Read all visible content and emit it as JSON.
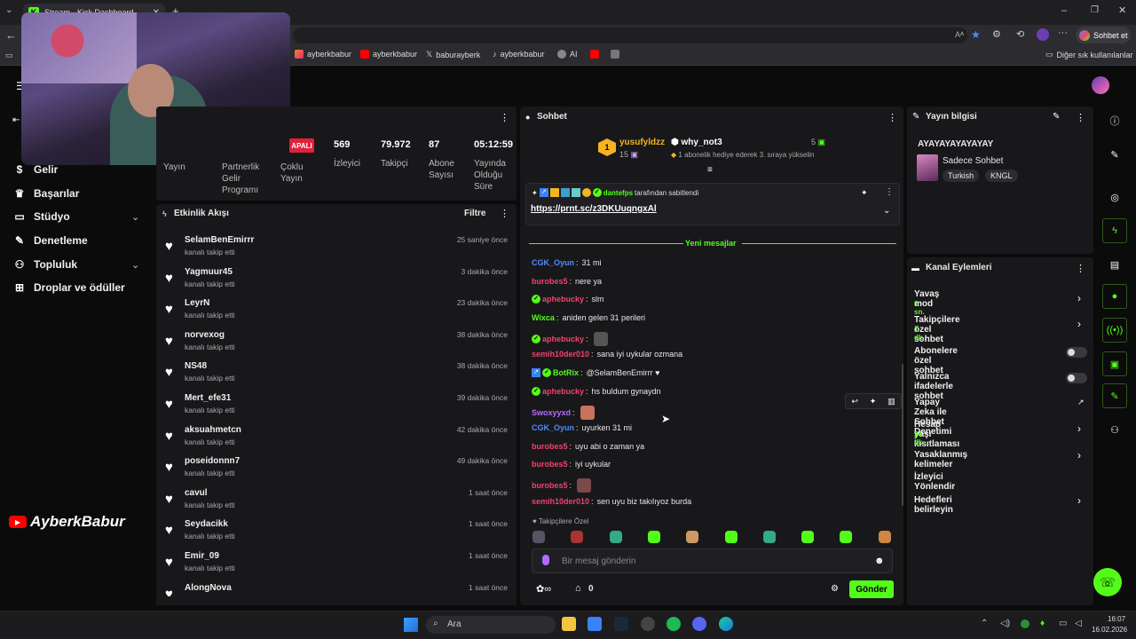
{
  "browser": {
    "tab_title": "Stream - Kick Dashboard",
    "copilot_label": "Sohbet et",
    "bookmarks": [
      "ayberkbabur",
      "ayberkbabur",
      "baburayberk",
      "ayberkbabur",
      "AI"
    ],
    "other_bookmarks": "Diğer sık kullanılanlar"
  },
  "sidebar": {
    "items": [
      {
        "label": "Gelir",
        "icon": "dollar-icon"
      },
      {
        "label": "Başarılar",
        "icon": "trophy-icon"
      },
      {
        "label": "Stüdyo",
        "icon": "studio-icon"
      },
      {
        "label": "Denetleme",
        "icon": "wrench-icon"
      },
      {
        "label": "Topluluk",
        "icon": "community-icon"
      },
      {
        "label": "Droplar ve ödüller",
        "icon": "gift-icon"
      }
    ],
    "watermark": "AyberkBabur"
  },
  "stats": {
    "badge": "APALI",
    "labels": [
      "Yayın",
      "Partnerlik Gelir Programı",
      "Çoklu Yayın"
    ],
    "items": [
      {
        "value": "569",
        "label": "İzleyici"
      },
      {
        "value": "79.972",
        "label": "Takipçi"
      },
      {
        "value": "87",
        "label": "Abone Sayısı"
      },
      {
        "value": "05:12:59",
        "label": "Yayında Olduğu Süre"
      }
    ]
  },
  "activity": {
    "title": "Etkinlik Akışı",
    "filter_label": "Filtre",
    "items": [
      {
        "name": "SelamBenEmirrr",
        "action": "kanalı takip etti",
        "time": "25 saniye önce"
      },
      {
        "name": "Yagmuur45",
        "action": "kanalı takip etti",
        "time": "3 dakika önce"
      },
      {
        "name": "LeyrN",
        "action": "kanalı takip etti",
        "time": "23 dakika önce"
      },
      {
        "name": "norvexog",
        "action": "kanalı takip etti",
        "time": "38 dakika önce"
      },
      {
        "name": "NS48",
        "action": "kanalı takip etti",
        "time": "38 dakika önce"
      },
      {
        "name": "Mert_efe31",
        "action": "kanalı takip etti",
        "time": "39 dakika önce"
      },
      {
        "name": "aksuahmetcn",
        "action": "kanalı takip etti",
        "time": "42 dakika önce"
      },
      {
        "name": "poseidonnn7",
        "action": "kanalı takip etti",
        "time": "49 dakika önce"
      },
      {
        "name": "cavul",
        "action": "kanalı takip etti",
        "time": "1 saat önce"
      },
      {
        "name": "Seydacikk",
        "action": "kanalı takip etti",
        "time": "1 saat önce"
      },
      {
        "name": "Emir_09",
        "action": "kanalı takip etti",
        "time": "1 saat önce"
      },
      {
        "name": "AlongNova",
        "action": "kanalı takip etti",
        "time": "1 saat önce"
      }
    ]
  },
  "chat": {
    "title": "Sohbet",
    "gift_top_user": "yusufyldzz",
    "gift_top_count": "15",
    "gift_user": "why_not3",
    "gift_count": "5",
    "gift_text": "1 abonelik hediye ederek 3. sıraya yükselin",
    "pinned_by": "dantefps",
    "pinned_suffix": "tarafından sabitlendi",
    "pinned_link": "https://prnt.sc/z3DKUuqngxAl",
    "new_messages": "Yeni mesajlar",
    "messages": [
      {
        "user": "CGK_Oyun",
        "text": "31 mi",
        "color": "#4f8df9"
      },
      {
        "user": "burobes5",
        "text": "nere ya",
        "color": "#f0426b"
      },
      {
        "user": "aphebucky",
        "text": "slm",
        "color": "#f0426b"
      },
      {
        "user": "Wixca",
        "text": "aniden gelen 31 perileri",
        "color": "#53fc18"
      },
      {
        "user": "aphebucky",
        "text": "",
        "color": "#f0426b"
      },
      {
        "user": "semih10der010",
        "text": "sana iyi uykular ozmana",
        "color": "#f0426b"
      },
      {
        "user": "BotRix",
        "text": "@SelamBenEmirrr ♥",
        "color": "#53fc18"
      },
      {
        "user": "aphebucky",
        "text": "hs buldum gynaydn",
        "color": "#f0426b"
      },
      {
        "user": "Swoxyyxd",
        "text": "",
        "color": "#b36cff"
      },
      {
        "user": "CGK_Oyun",
        "text": "uyurken 31 mi",
        "color": "#4f8df9"
      },
      {
        "user": "burobes5",
        "text": "uyu abi o zaman ya",
        "color": "#f0426b"
      },
      {
        "user": "burobes5",
        "text": "iyi uykular",
        "color": "#f0426b"
      },
      {
        "user": "burobes5",
        "text": "",
        "color": "#f0426b"
      },
      {
        "user": "semih10der010",
        "text": "sen uyu biz takılıyoz burda",
        "color": "#f0426b"
      }
    ],
    "followers_only": "Takipçilere Özel",
    "input_placeholder": "Bir mesaj gönderin",
    "points": "0",
    "send_label": "Gönder"
  },
  "stream_info": {
    "title": "Yayın bilgisi",
    "stream_title": "AYAYAYAYAYAYAY",
    "category": "Sadece Sohbet",
    "tags": [
      "Turkish",
      "KNGL"
    ]
  },
  "channel_actions": {
    "title": "Kanal Eylemleri",
    "items": [
      {
        "label": "Yavaş mod",
        "sub": "1 sn.",
        "type": "chevron"
      },
      {
        "label": "Takipçilere özel sohbet",
        "sub": "1 dk.",
        "type": "chevron"
      },
      {
        "label": "Abonelere özel sohbet",
        "sub": "",
        "type": "toggle"
      },
      {
        "label": "Yalnızca ifadelerle sohbet",
        "sub": "",
        "type": "toggle"
      },
      {
        "label": "Yapay Zeka ile Sohbet Denetimi",
        "sub": "",
        "type": "external"
      },
      {
        "label": "Hesap yaşı kısıtlaması",
        "sub": "24 dk.",
        "type": "chevron"
      },
      {
        "label": "Yasaklanmış kelimeler",
        "sub": "",
        "type": "chevron"
      },
      {
        "label": "İzleyici Yönlendir",
        "sub": "",
        "type": "none"
      },
      {
        "label": "Hedefleri belirleyin",
        "sub": "",
        "type": "chevron"
      }
    ]
  },
  "taskbar": {
    "search": "Ara",
    "time": "16:07",
    "date": "16.02.2026"
  },
  "colors": {
    "accent": "#53fc18",
    "panel": "#18181b",
    "bg": "#0b0b0c"
  }
}
